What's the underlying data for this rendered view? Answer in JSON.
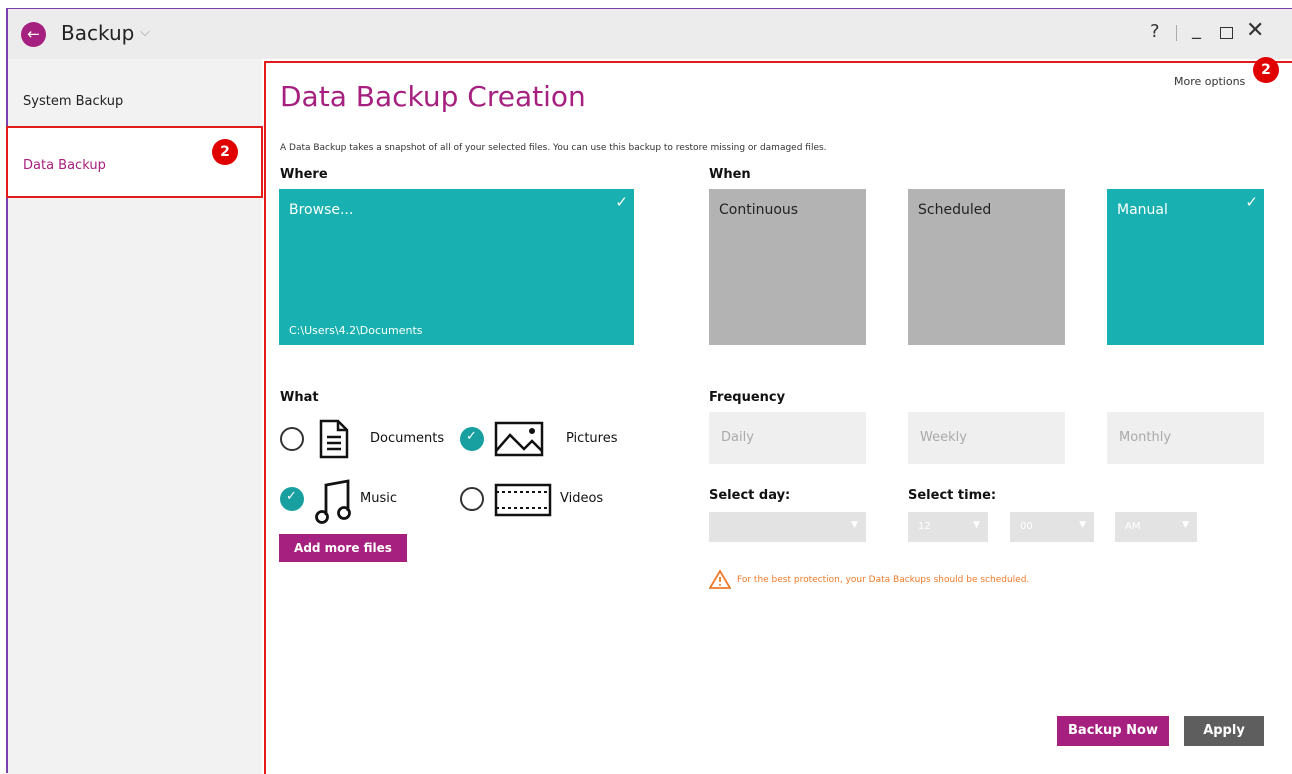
{
  "window": {
    "title": "Backup",
    "help_label": "?",
    "accent_color": "#a6217f",
    "teal_color": "#18b0b0"
  },
  "sidebar": {
    "items": [
      {
        "label": "System Backup"
      },
      {
        "label": "Data Backup"
      }
    ]
  },
  "annotations": {
    "sidebar_badge": "2",
    "main_badge": "2"
  },
  "main": {
    "title": "Data Backup Creation",
    "more_options": "More options",
    "intro": "A Data Backup takes a snapshot of all of your selected files. You can use this backup to restore missing or damaged files.",
    "where": {
      "label": "Where",
      "browse_label": "Browse...",
      "path": "C:\\Users\\4.2\\Documents"
    },
    "when": {
      "label": "When",
      "options": [
        {
          "label": "Continuous",
          "selected": false
        },
        {
          "label": "Scheduled",
          "selected": false
        },
        {
          "label": "Manual",
          "selected": true
        }
      ]
    },
    "what": {
      "label": "What",
      "items": [
        {
          "label": "Documents",
          "icon": "document-icon",
          "checked": false
        },
        {
          "label": "Pictures",
          "icon": "picture-icon",
          "checked": true
        },
        {
          "label": "Music",
          "icon": "music-icon",
          "checked": true
        },
        {
          "label": "Videos",
          "icon": "film-icon",
          "checked": false
        }
      ],
      "add_button": "Add more files"
    },
    "frequency": {
      "label": "Frequency",
      "options": [
        "Daily",
        "Weekly",
        "Monthly"
      ]
    },
    "schedule": {
      "day_label": "Select day:",
      "time_label": "Select time:",
      "day_value": "",
      "hour_value": "12",
      "minute_value": "00",
      "ampm_value": "AM"
    },
    "warning": "For the best protection, your Data Backups should be scheduled.",
    "backup_now": "Backup Now",
    "apply": "Apply"
  }
}
